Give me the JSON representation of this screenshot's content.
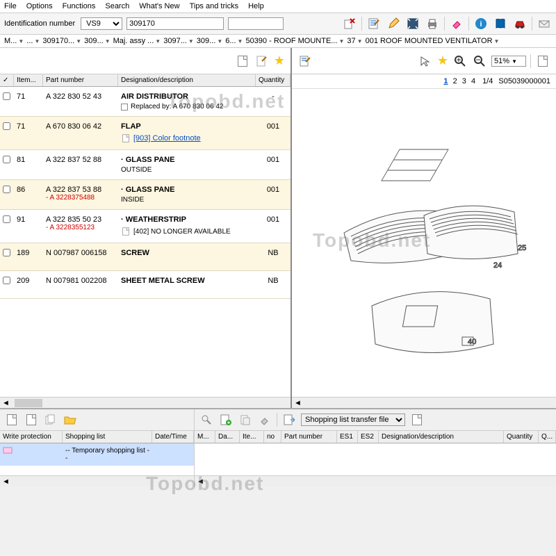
{
  "menu": [
    "File",
    "Options",
    "Functions",
    "Search",
    "What's New",
    "Tips and tricks",
    "Help"
  ],
  "idbar": {
    "label": "Identification number",
    "type_value": "VS9",
    "id_value": "309170"
  },
  "breadcrumb": [
    "M...",
    "...",
    "309170...",
    "309...",
    "Maj. assy ...",
    "3097...",
    "309...",
    "6...",
    "50390 - ROOF MOUNTE...",
    "37",
    "001 ROOF MOUNTED VENTILATOR"
  ],
  "parts_table": {
    "headers": [
      "✓",
      "Item...",
      "Part number",
      "Designation/description",
      "Quantity"
    ],
    "rows": [
      {
        "item": "71",
        "pn": "A 322 830 52 43",
        "pn_sub": "",
        "desc": "AIR DISTRIBUTOR",
        "note_type": "replaced",
        "note": "Replaced by: A 670 830 06 42",
        "qty": "-",
        "alt": false
      },
      {
        "item": "71",
        "pn": "A 670 830 06 42",
        "pn_sub": "",
        "desc": "FLAP",
        "note_type": "link",
        "note": "[903] Color footnote",
        "qty": "001",
        "alt": true
      },
      {
        "item": "81",
        "pn": "A 322 837 52 88",
        "pn_sub": "",
        "desc": "· GLASS PANE",
        "note_type": "sub",
        "note": "OUTSIDE",
        "qty": "001",
        "alt": false
      },
      {
        "item": "86",
        "pn": "A 322 837 53 88",
        "pn_sub": "- A 3228375488",
        "desc": "· GLASS PANE",
        "note_type": "sub",
        "note": "INSIDE",
        "qty": "001",
        "alt": true
      },
      {
        "item": "91",
        "pn": "A 322 835 50 23",
        "pn_sub": "- A 3228355123",
        "desc": "· WEATHERSTRIP",
        "note_type": "doc",
        "note": "[402] NO LONGER AVAILABLE",
        "qty": "001",
        "alt": false
      },
      {
        "item": "189",
        "pn": "N 007987 006158",
        "pn_sub": "",
        "desc": "SCREW",
        "note_type": "",
        "note": "",
        "qty": "NB",
        "alt": true
      },
      {
        "item": "209",
        "pn": "N 007981 002208",
        "pn_sub": "",
        "desc": "SHEET METAL SCREW",
        "note_type": "",
        "note": "",
        "qty": "NB",
        "alt": false
      }
    ]
  },
  "viewer": {
    "zoom": "51%",
    "pages": [
      "1",
      "2",
      "3",
      "4"
    ],
    "page_indicator": "1/4",
    "doc_id": "S05039000001"
  },
  "bottom": {
    "transfer_label": "Shopping list transfer file",
    "left_headers": [
      "Write protection",
      "Shopping list",
      "Date/Time"
    ],
    "left_row": {
      "wp": "",
      "name": "-- Temporary shopping list --",
      "dt": ""
    },
    "right_headers": [
      "M...",
      "Da...",
      "Ite...",
      "no",
      "Part number",
      "ES1",
      "ES2",
      "Designation/description",
      "Quantity",
      "Q..."
    ]
  },
  "watermark": "Topobd.net"
}
